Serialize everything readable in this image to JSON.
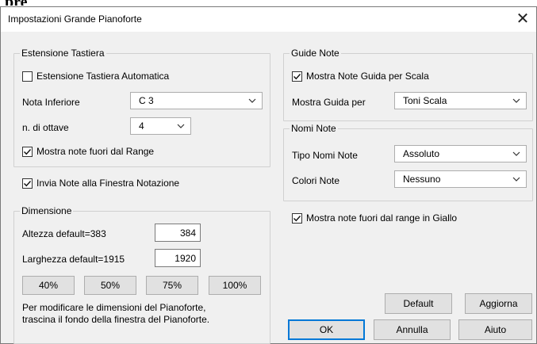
{
  "page_heading": "pre",
  "window": {
    "title": "Impostazioni Grande Pianoforte",
    "close_symbol": "✕"
  },
  "keyboard_range": {
    "label": "Estensione Tastiera",
    "auto_label": "Estensione Tastiera Automatica",
    "auto_checked": false,
    "lowest_note_label": "Nota Inferiore",
    "lowest_note_value": "C 3",
    "octaves_label": "n. di ottave",
    "octaves_value": "4",
    "show_out_of_range_label": "Mostra note fuori dal Range",
    "show_out_of_range_checked": true
  },
  "send_notes": {
    "label": "Invia Note alla Finestra Notazione",
    "checked": true
  },
  "size": {
    "label": "Dimensione",
    "height_label": "Altezza  default=383",
    "height_value": "384",
    "width_label": "Larghezza  default=1915",
    "width_value": "1920",
    "presets": [
      "40%",
      "50%",
      "75%",
      "100%"
    ],
    "note_line1": "Per modificare le dimensioni del Pianoforte,",
    "note_line2": "trascina il fondo della finestra del Pianoforte."
  },
  "guide_notes": {
    "label": "Guide Note",
    "show_guide_label": "Mostra Note Guida per Scala",
    "show_guide_checked": true,
    "show_guide_for_label": "Mostra Guida per",
    "show_guide_for_value": "Toni Scala"
  },
  "note_names": {
    "label": "Nomi Note",
    "type_label": "Tipo Nomi Note",
    "type_value": "Assoluto",
    "colors_label": "Colori Note",
    "colors_value": "Nessuno"
  },
  "yellow_out_of_range": {
    "label": "Mostra note fuori dal range in Giallo",
    "checked": true
  },
  "buttons": {
    "default": "Default",
    "update": "Aggiorna",
    "ok": "OK",
    "cancel": "Annulla",
    "help": "Aiuto"
  },
  "colors": {
    "dialog_bg": "#f0f0f0",
    "focus_border": "#0078d7",
    "button_bg": "#e1e1e1"
  }
}
